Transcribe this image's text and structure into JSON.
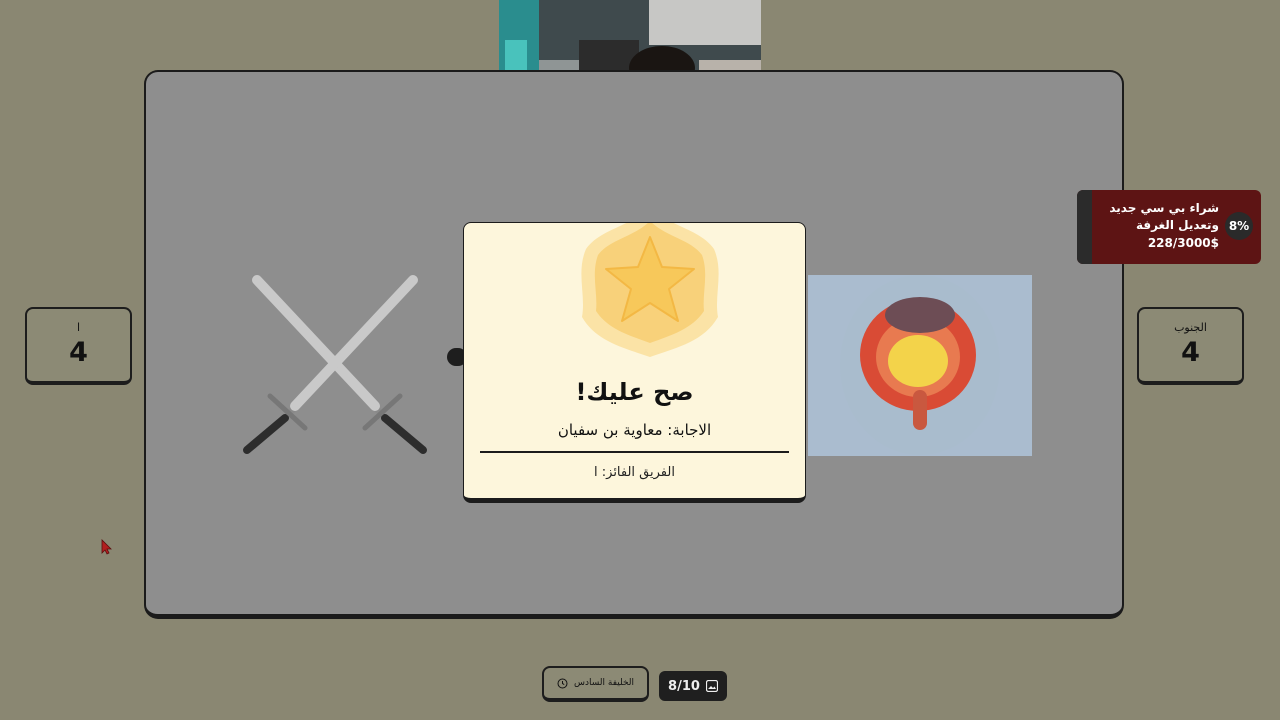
{
  "teams": {
    "left": {
      "name": "ا",
      "score": "4"
    },
    "right": {
      "name": "الجنوب",
      "score": "4"
    }
  },
  "donation": {
    "title": "شراء بي سي جديد وتعديل الغرفة",
    "amount": "228/3000$",
    "percent": "8%",
    "progress_fraction": 0.08
  },
  "modal": {
    "title": "صح عليك!",
    "answer": "الاجابة: معاوية بن سفيان",
    "winner": "الفريق الفائز: ا"
  },
  "footer": {
    "category": "الخليفة السادس",
    "counter": "8/10"
  },
  "colors": {
    "background": "#8a8772",
    "modal": "#fdf6dc",
    "donation": "#5d1414",
    "star": "#f7c85a"
  },
  "icons": [
    "swords-icon",
    "star-icon",
    "clock-icon",
    "image-icon",
    "cursor-icon"
  ]
}
